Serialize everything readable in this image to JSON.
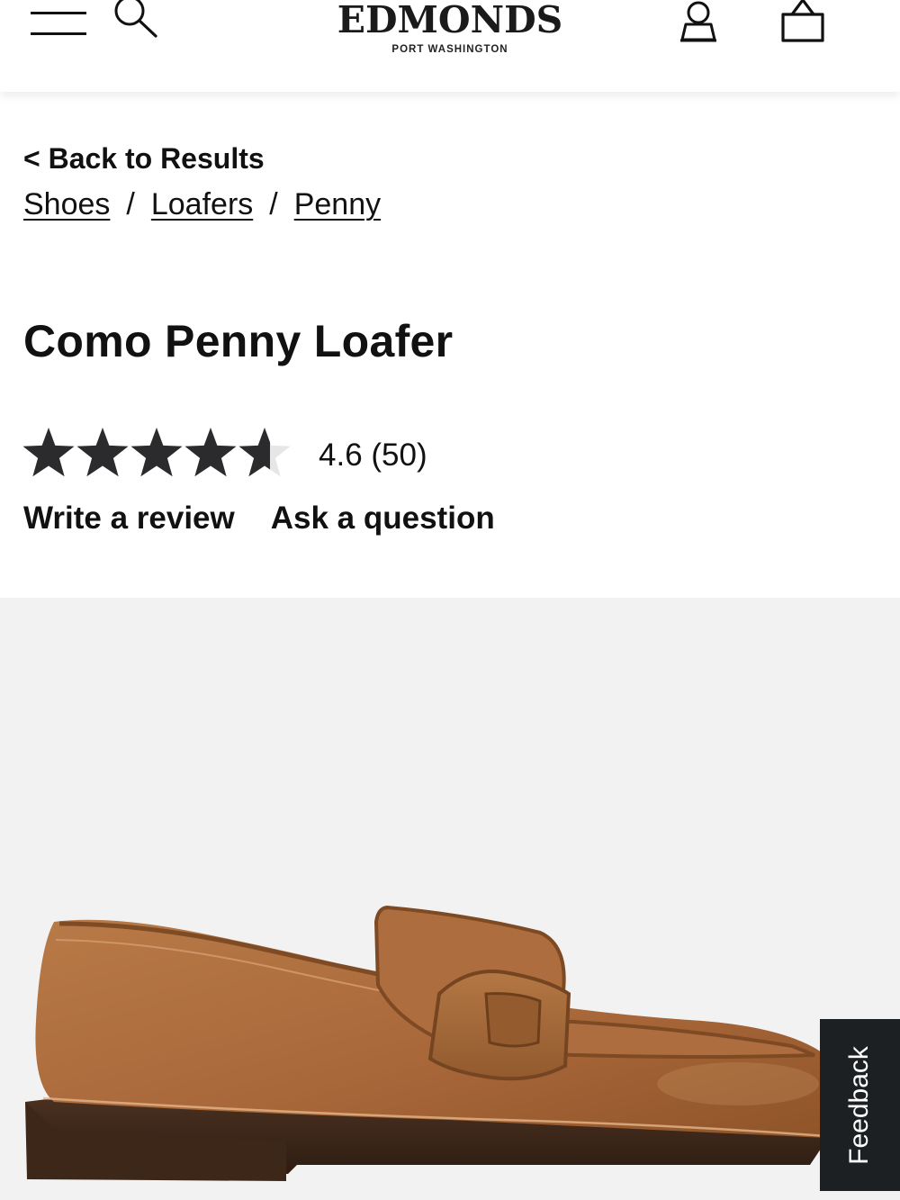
{
  "header": {
    "brand_name": "EDMONDS",
    "brand_subtitle": "PORT WASHINGTON",
    "icons": [
      "menu-icon",
      "search-icon",
      "account-icon",
      "shopping-bag-icon"
    ]
  },
  "navigation": {
    "back_label": "< Back to Results",
    "breadcrumbs": [
      {
        "label": "Shoes"
      },
      {
        "label": "Loafers"
      },
      {
        "label": "Penny"
      }
    ],
    "separator": "/"
  },
  "product": {
    "title": "Como Penny Loafer",
    "rating_value": 4.6,
    "rating_max": 5,
    "rating_text": "4.6 (50)",
    "write_review_label": "Write a review",
    "ask_question_label": "Ask a question",
    "image": {
      "subject": "penny-loafer-shoe-image",
      "background_color": "#f2f2f3",
      "leather_color": "#a9683a"
    }
  },
  "feedback": {
    "label": "Feedback",
    "background_color": "#1d2022"
  },
  "colors": {
    "text": "#111111",
    "star_filled": "#2b2b2d",
    "star_empty": "#e6e6e6"
  }
}
